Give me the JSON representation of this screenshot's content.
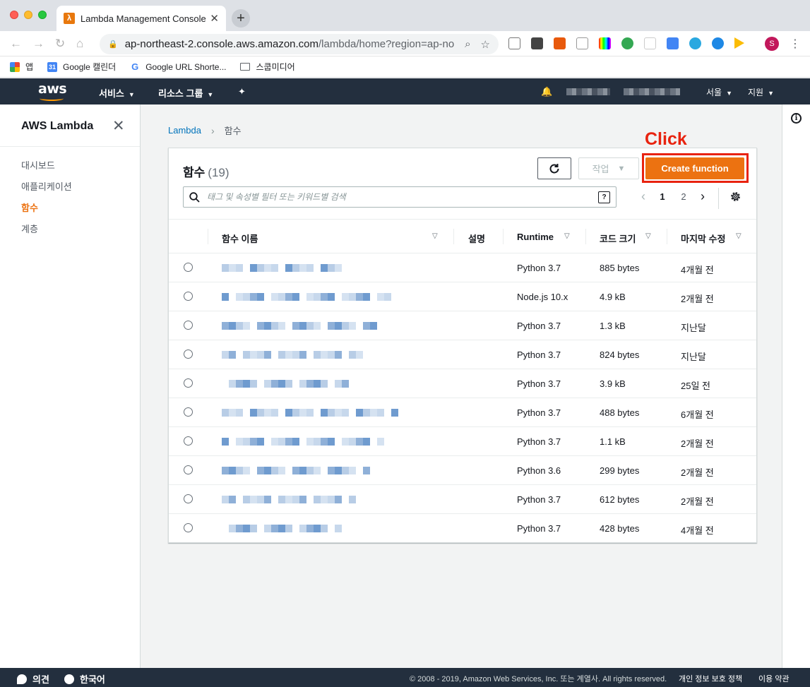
{
  "browser": {
    "tab_title": "Lambda Management Console",
    "url_host": "ap-northeast-2.console.aws.amazon.com",
    "url_path": "/lambda/home?region=ap-nor...",
    "bookmarks": [
      {
        "label": "앱"
      },
      {
        "label": "Google 캘린더"
      },
      {
        "label": "Google URL Shorte..."
      },
      {
        "label": "스쿱미디어"
      }
    ],
    "profile_initial": "S"
  },
  "aws_header": {
    "logo": "aws",
    "services": "서비스",
    "resource_groups": "리소스 그룹",
    "region": "서울",
    "support": "지원"
  },
  "sidenav": {
    "title": "AWS Lambda",
    "items": [
      {
        "label": "대시보드",
        "active": false
      },
      {
        "label": "애플리케이션",
        "active": false
      },
      {
        "label": "함수",
        "active": true
      },
      {
        "label": "계층",
        "active": false
      }
    ]
  },
  "breadcrumb": {
    "parent": "Lambda",
    "current": "함수"
  },
  "annotation": {
    "click_label": "Click"
  },
  "panel": {
    "title": "함수",
    "count": "(19)",
    "action_label": "작업",
    "create_label": "Create function",
    "search_placeholder": "태그 및 속성별 필터 또는 키워드별 검색",
    "pages": [
      "1",
      "2"
    ],
    "current_page": "1"
  },
  "table": {
    "columns": [
      "함수 이름",
      "설명",
      "Runtime",
      "코드 크기",
      "마지막 수정"
    ],
    "rows": [
      {
        "runtime": "Python 3.7",
        "size": "885 bytes",
        "modified": "4개월 전"
      },
      {
        "runtime": "Node.js 10.x",
        "size": "4.9 kB",
        "modified": "2개월 전"
      },
      {
        "runtime": "Python 3.7",
        "size": "1.3 kB",
        "modified": "지난달"
      },
      {
        "runtime": "Python 3.7",
        "size": "824 bytes",
        "modified": "지난달"
      },
      {
        "runtime": "Python 3.7",
        "size": "3.9 kB",
        "modified": "25일 전"
      },
      {
        "runtime": "Python 3.7",
        "size": "488 bytes",
        "modified": "6개월 전"
      },
      {
        "runtime": "Python 3.7",
        "size": "1.1 kB",
        "modified": "2개월 전"
      },
      {
        "runtime": "Python 3.6",
        "size": "299 bytes",
        "modified": "2개월 전"
      },
      {
        "runtime": "Python 3.7",
        "size": "612 bytes",
        "modified": "2개월 전"
      },
      {
        "runtime": "Python 3.7",
        "size": "428 bytes",
        "modified": "4개월 전"
      }
    ]
  },
  "footer": {
    "feedback": "의견",
    "language": "한국어",
    "copyright": "© 2008 - 2019, Amazon Web Services, Inc. 또는 계열사. All rights reserved.",
    "privacy": "개인 정보 보호 정책",
    "terms": "이용 약관"
  },
  "colors": {
    "aws_nav": "#232f3e",
    "accent_orange": "#ec7211",
    "link_blue": "#0073bb",
    "annotation_red": "#e8230f"
  }
}
